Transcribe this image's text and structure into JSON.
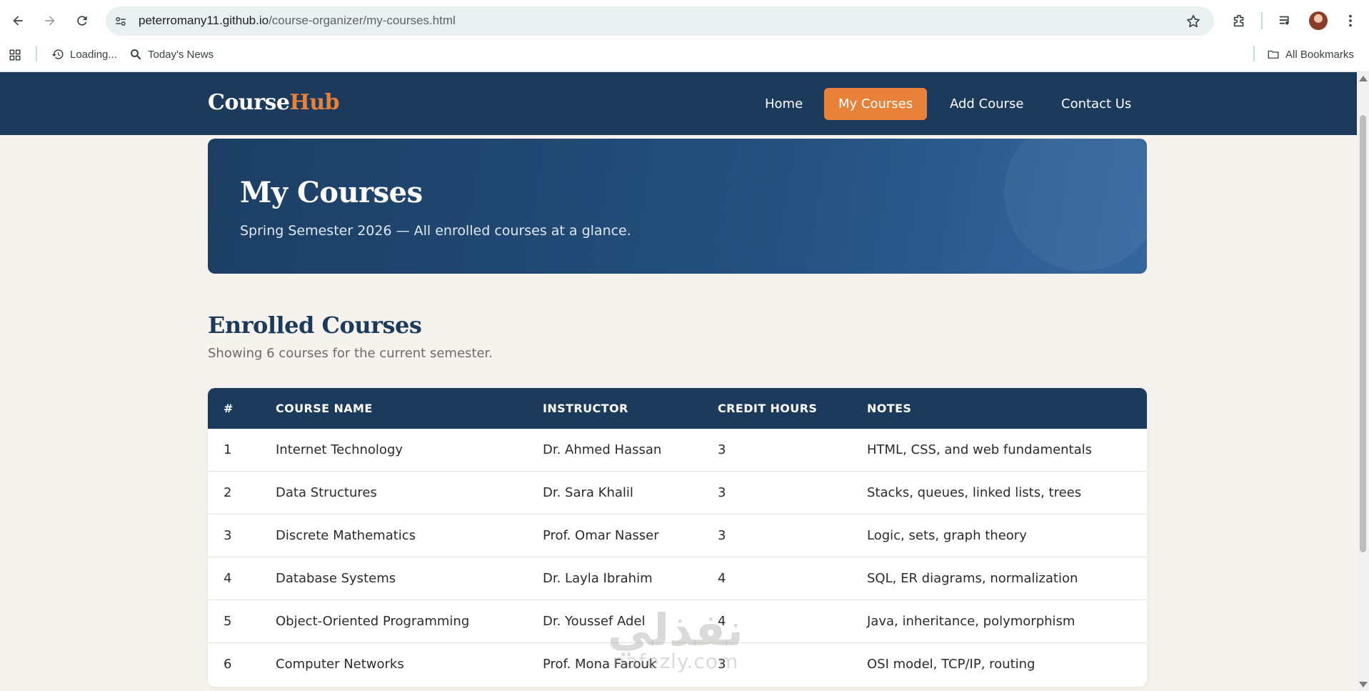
{
  "browser": {
    "url_host": "peterromany11.github.io",
    "url_path": "/course-organizer/my-courses.html",
    "bookmarks": [
      {
        "label": "Loading...",
        "icon": "history-icon"
      },
      {
        "label": "Today's News",
        "icon": "search-icon"
      }
    ],
    "all_bookmarks_label": "All Bookmarks"
  },
  "site": {
    "logo_main": "Course",
    "logo_accent": "Hub",
    "nav": [
      {
        "label": "Home",
        "active": false
      },
      {
        "label": "My Courses",
        "active": true
      },
      {
        "label": "Add Course",
        "active": false
      },
      {
        "label": "Contact Us",
        "active": false
      }
    ]
  },
  "hero": {
    "title": "My Courses",
    "subtitle": "Spring Semester 2026 — All enrolled courses at a glance."
  },
  "section": {
    "title": "Enrolled Courses",
    "subtitle": "Showing 6 courses for the current semester."
  },
  "table": {
    "headers": [
      "#",
      "COURSE NAME",
      "INSTRUCTOR",
      "CREDIT HOURS",
      "NOTES"
    ],
    "rows": [
      {
        "num": "1",
        "name": "Internet Technology",
        "instructor": "Dr. Ahmed Hassan",
        "credits": "3",
        "notes": "HTML, CSS, and web fundamentals"
      },
      {
        "num": "2",
        "name": "Data Structures",
        "instructor": "Dr. Sara Khalil",
        "credits": "3",
        "notes": "Stacks, queues, linked lists, trees"
      },
      {
        "num": "3",
        "name": "Discrete Mathematics",
        "instructor": "Prof. Omar Nasser",
        "credits": "3",
        "notes": "Logic, sets, graph theory"
      },
      {
        "num": "4",
        "name": "Database Systems",
        "instructor": "Dr. Layla Ibrahim",
        "credits": "4",
        "notes": "SQL, ER diagrams, normalization"
      },
      {
        "num": "5",
        "name": "Object-Oriented Programming",
        "instructor": "Dr. Youssef Adel",
        "credits": "4",
        "notes": "Java, inheritance, polymorphism"
      },
      {
        "num": "6",
        "name": "Computer Networks",
        "instructor": "Prof. Mona Farouk",
        "credits": "3",
        "notes": "OSI model, TCP/IP, routing"
      }
    ]
  },
  "watermark": {
    "arabic": "نفذلي",
    "latin": "nafezly.com"
  },
  "colors": {
    "header_bg": "#1b3a5c",
    "accent": "#e8823a",
    "page_bg": "#f6f3ee"
  }
}
